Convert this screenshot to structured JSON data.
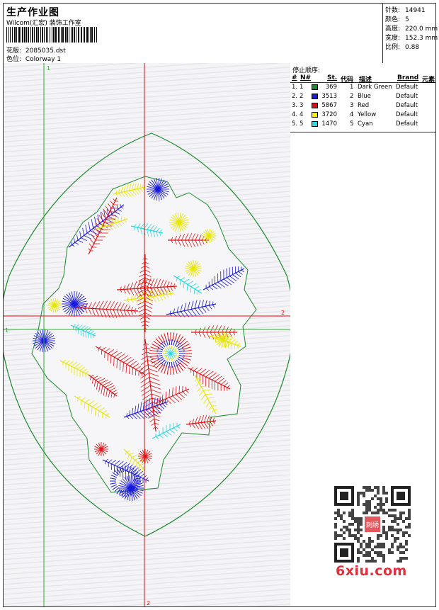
{
  "header": {
    "title": "生产作业图",
    "company": "Wilcom(汇宏) 装饰工作室",
    "design_label": "花版:",
    "design_value": "2085035.dst",
    "color_label": "色位:",
    "color_value": "Colorway 1"
  },
  "stats": [
    {
      "label": "针数:",
      "value": "14941"
    },
    {
      "label": "颜色:",
      "value": "5"
    },
    {
      "label": "高度:",
      "value": "220.0 mm"
    },
    {
      "label": "宽度:",
      "value": "152.3 mm"
    },
    {
      "label": "比例:",
      "value": "0.88"
    }
  ],
  "stop_sequence": {
    "title": "停止顺序:",
    "columns": [
      "#",
      "N#",
      "St.",
      "代码",
      "描述",
      "Brand",
      "元素"
    ],
    "rows": [
      {
        "num": "1.",
        "n": "1",
        "stitches": "369",
        "code": "1",
        "desc": "Dark Green",
        "brand": "Default",
        "color": "#1a8a2a"
      },
      {
        "num": "2.",
        "n": "2",
        "stitches": "3513",
        "code": "2",
        "desc": "Blue",
        "brand": "Default",
        "color": "#1a1adc"
      },
      {
        "num": "3.",
        "n": "3",
        "stitches": "5867",
        "code": "3",
        "desc": "Red",
        "brand": "Default",
        "color": "#e01010"
      },
      {
        "num": "4.",
        "n": "4",
        "stitches": "3720",
        "code": "4",
        "desc": "Yellow",
        "brand": "Default",
        "color": "#f4f400"
      },
      {
        "num": "5.",
        "n": "5",
        "stitches": "1470",
        "code": "5",
        "desc": "Cyan",
        "brand": "Default",
        "color": "#22e0e0"
      }
    ]
  },
  "guides": {
    "top": "1",
    "bottom": "2",
    "left": "1",
    "right": "2"
  },
  "watermark": {
    "site": "6xiu.com",
    "stamp_char": "刺绣"
  },
  "colors": {
    "guide_green": "#2ab52a",
    "guide_red": "#e01010",
    "outline_green": "#1a8a2a"
  }
}
